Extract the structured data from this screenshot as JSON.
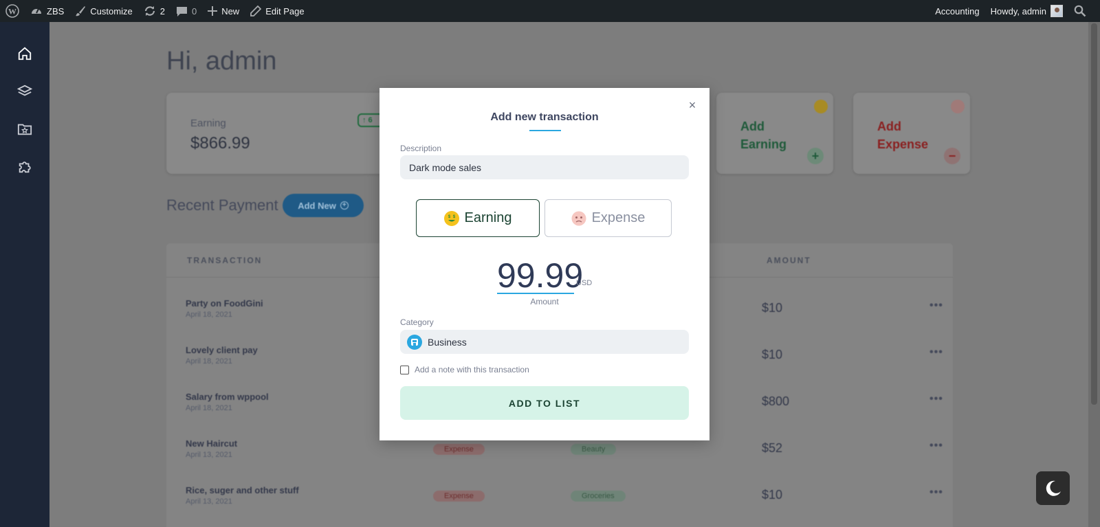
{
  "admin_bar": {
    "site_name": "ZBS",
    "customize": "Customize",
    "updates_count": "2",
    "comments_count": "0",
    "new_label": "New",
    "edit_page": "Edit Page",
    "accounting": "Accounting",
    "howdy": "Howdy, admin"
  },
  "sidebar": {
    "items": [
      "home-icon",
      "layers-icon",
      "folder-star-icon",
      "puzzle-icon"
    ]
  },
  "dashboard": {
    "greeting": "Hi, admin",
    "earning_card": {
      "label": "Earning",
      "value": "$866.99",
      "badge": "↑ 6"
    },
    "quick_earning": {
      "line1": "Add",
      "line2": "Earning",
      "symbol": "+"
    },
    "quick_expense": {
      "line1": "Add",
      "line2": "Expense",
      "symbol": "−"
    },
    "recent_title": "Recent Payment",
    "add_new_label": "Add New",
    "table": {
      "headers": {
        "transaction": "TRANSACTION",
        "amount": "AMOUNT"
      },
      "rows": [
        {
          "title": "Party on FoodGini",
          "date": "April 18, 2021",
          "type": "",
          "category": "",
          "amount": "$10"
        },
        {
          "title": "Lovely client pay",
          "date": "April 18, 2021",
          "type": "",
          "category": "",
          "amount": "$10"
        },
        {
          "title": "Salary from wppool",
          "date": "April 18, 2021",
          "type": "",
          "category": "",
          "amount": "$800"
        },
        {
          "title": "New Haircut",
          "date": "April 13, 2021",
          "type": "Expense",
          "category": "Beauty",
          "amount": "$52"
        },
        {
          "title": "Rice, suger and other stuff",
          "date": "April 13, 2021",
          "type": "Expense",
          "category": "Groceries",
          "amount": "$10"
        }
      ]
    }
  },
  "modal": {
    "title": "Add new transaction",
    "close_symbol": "×",
    "description_label": "Description",
    "description_value": "Dark mode sales",
    "type_earning": "Earning",
    "type_expense": "Expense",
    "selected_type": "Earning",
    "amount_value": "99.99",
    "amount_currency": "USD",
    "amount_label": "Amount",
    "category_label": "Category",
    "category_value": "Business",
    "note_label": "Add a note with this transaction",
    "note_checked": false,
    "submit_label": "ADD TO LIST"
  },
  "colors": {
    "accent_blue": "#2aa7e0",
    "earning_green": "#1b4332",
    "submit_bg": "#d6f3e8",
    "sidebar_bg": "#1d2637",
    "adminbar_bg": "#1d2327"
  }
}
